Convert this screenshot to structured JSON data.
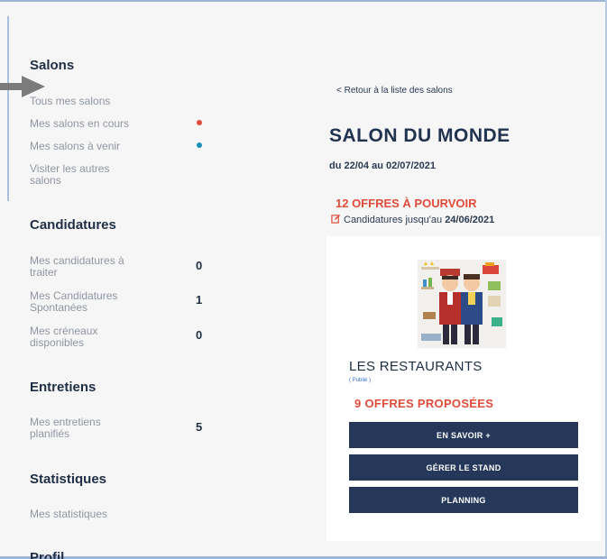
{
  "sidebar": {
    "salons": {
      "title": "Salons",
      "items": [
        {
          "label": "Tous mes salons"
        },
        {
          "label": "Mes salons en cours",
          "dot_color": "#e04b3a"
        },
        {
          "label": "Mes salons à venir",
          "dot_color": "#1a8fb8"
        },
        {
          "label": "Visiter les autres salons"
        }
      ]
    },
    "candidatures": {
      "title": "Candidatures",
      "items": [
        {
          "label": "Mes candidatures à traiter",
          "count": "0"
        },
        {
          "label": "Mes Candidatures Spontanées",
          "count": "1"
        },
        {
          "label": "Mes créneaux disponibles",
          "count": "0"
        }
      ]
    },
    "entretiens": {
      "title": "Entretiens",
      "items": [
        {
          "label": "Mes entretiens planifiés",
          "count": "5"
        }
      ]
    },
    "statistiques": {
      "title": "Statistiques",
      "items": [
        {
          "label": "Mes statistiques"
        }
      ]
    },
    "profil": {
      "title": "Profil"
    }
  },
  "main": {
    "back_link": "< Retour à la liste des salons",
    "salon_title": "SALON DU MONDE",
    "dates": "du 22/04 au 02/07/2021",
    "offres": "12 OFFRES À POURVOIR",
    "deadline_prefix": "Candidatures jusqu'au ",
    "deadline_date": "24/06/2021",
    "stand": {
      "name": "LES RESTAURANTS",
      "status": "( Publié )",
      "offres": "9 OFFRES PROPOSÉES",
      "buttons": {
        "savoir": "EN SAVOIR +",
        "gerer": "GÉRER LE STAND",
        "planning": "PLANNING"
      }
    }
  },
  "colors": {
    "accent_red": "#e04b3a",
    "navy": "#26385a",
    "dot_blue": "#1a8fb8"
  }
}
